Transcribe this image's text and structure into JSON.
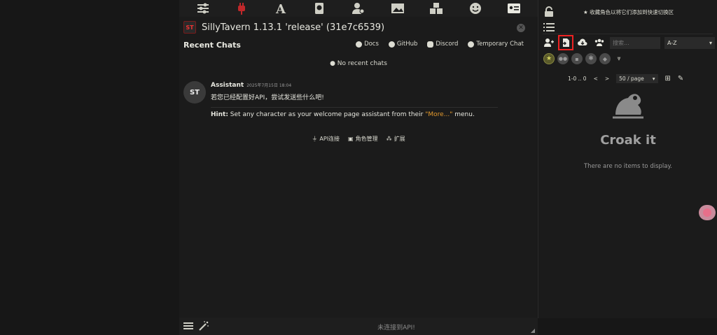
{
  "app": {
    "title": "SillyTavern 1.13.1 'release' (31e7c6539)",
    "logo_text": "ST"
  },
  "nav": {
    "icons": [
      "sliders-icon",
      "plug-icon",
      "font-icon",
      "book-icon",
      "user-cog-icon",
      "image-icon",
      "cubes-icon",
      "smile-icon",
      "id-card-icon"
    ]
  },
  "welcome": {
    "recent_title": "Recent Chats",
    "links": [
      {
        "label": "Docs",
        "icon": "question-circle-icon"
      },
      {
        "label": "GitHub",
        "icon": "github-icon"
      },
      {
        "label": "Discord",
        "icon": "discord-icon"
      },
      {
        "label": "Temporary Chat",
        "icon": "comment-icon"
      }
    ],
    "no_recent": "No recent chats",
    "message": {
      "name": "Assistant",
      "time": "2025年7月15日 18:04",
      "text": "若您已经配置好API，尝试发送些什么吧!",
      "hint_label": "Hint:",
      "hint_text": " Set any character as your welcome page assistant from their ",
      "hint_more": "\"More...\"",
      "hint_end": " menu."
    },
    "shortcuts": [
      {
        "label": "API连接",
        "icon": "plug-icon"
      },
      {
        "label": "角色管理",
        "icon": "id-card-icon"
      },
      {
        "label": "扩展",
        "icon": "cubes-icon"
      }
    ]
  },
  "bottom": {
    "status": "未连接到API!"
  },
  "right_panel": {
    "fav_hint": "★ 收藏角色以将它们添加到快速切换区",
    "search_placeholder": "搜索...",
    "sort_value": "A-Z",
    "pager": {
      "range": "1-0 .. 0",
      "prev": "<",
      "next": ">",
      "per_page": "50 / page"
    },
    "empty_title": "Croak it",
    "empty_text": "There are no items to display."
  },
  "colors": {
    "accent_orange": "#e49a2d",
    "highlight_red": "#e22222",
    "bg": "#171717"
  }
}
